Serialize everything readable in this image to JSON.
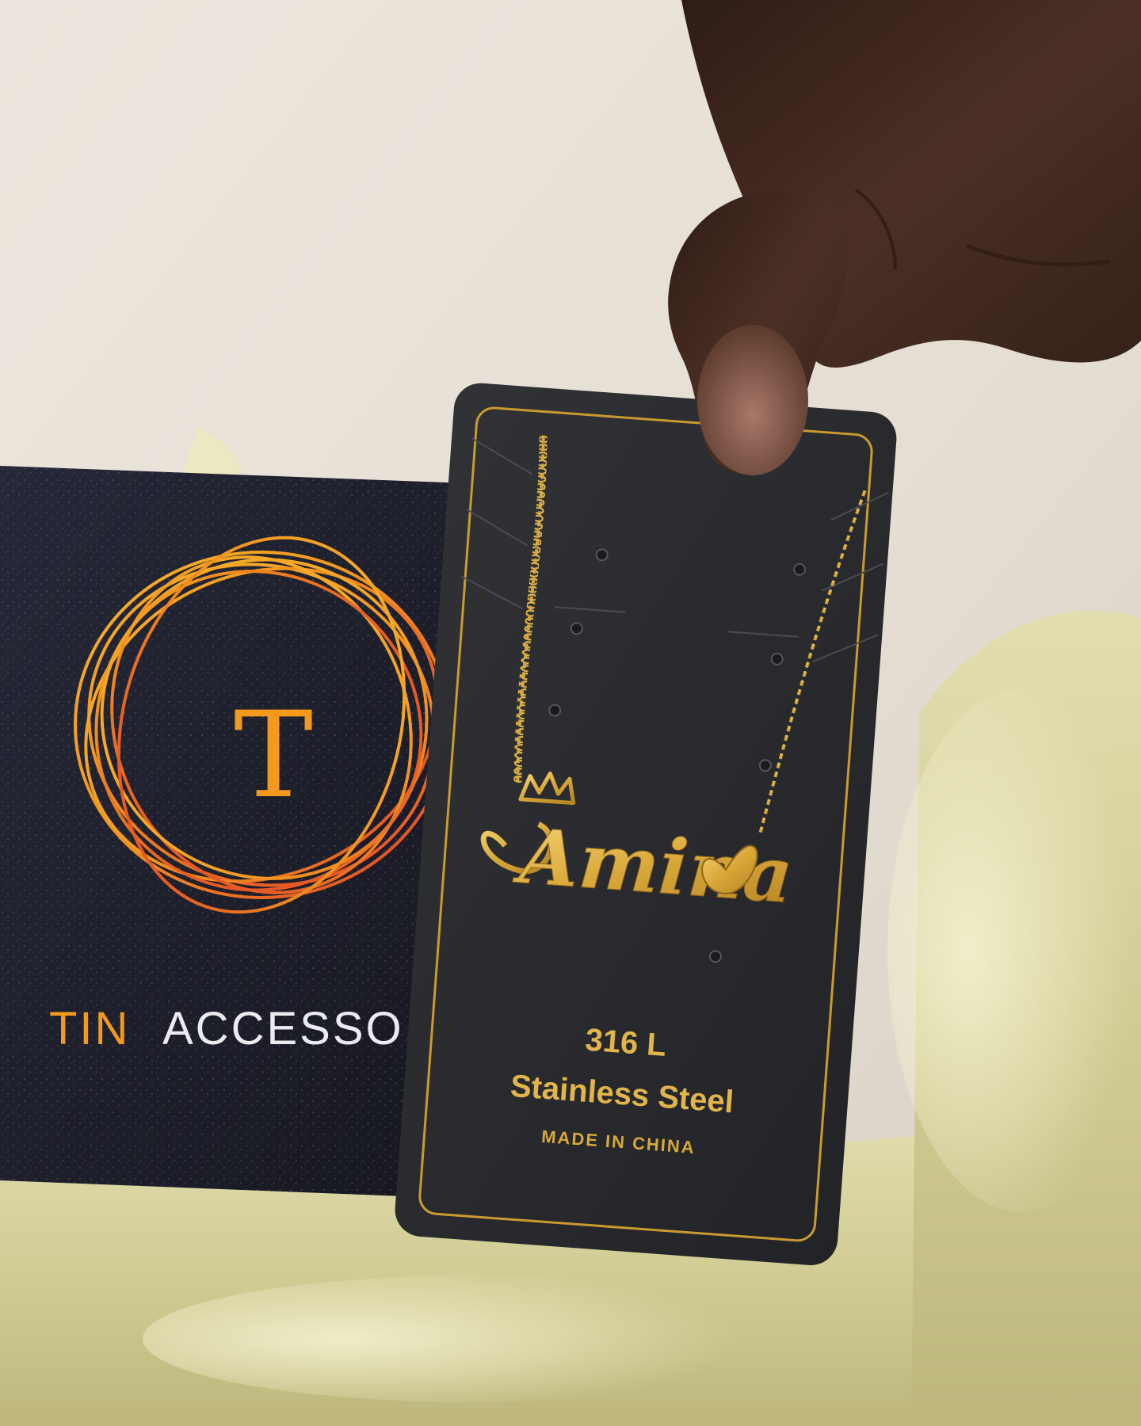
{
  "box": {
    "monogram": "T",
    "brand_word1": "TIN",
    "brand_word2": "ACCESSO"
  },
  "card": {
    "grade": "316 L",
    "material": "Stainless Steel",
    "origin": "MADE IN CHINA"
  },
  "pendant": {
    "name": "Amina"
  },
  "colors": {
    "wall": "#e9e3da",
    "satin": "#d8d4a2",
    "box": "#1e2030",
    "card": "#2a2b2f",
    "gold": "#d8a93a",
    "gold_light": "#f1c65a",
    "logo_orange": "#f39a1c",
    "logo_red": "#e0442a",
    "skin": "#4a2e22"
  }
}
